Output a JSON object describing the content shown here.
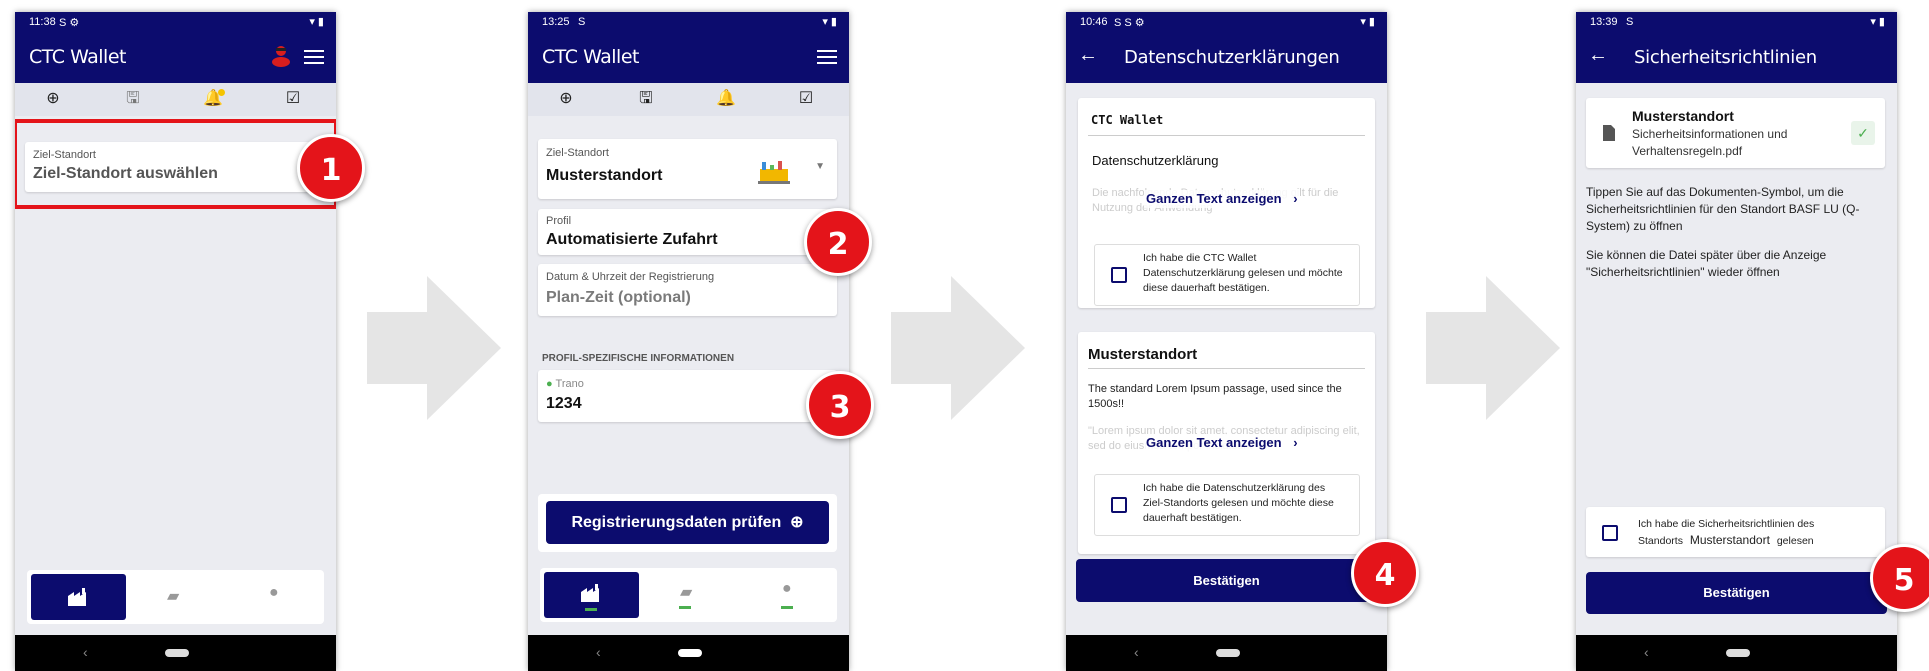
{
  "screens": [
    {
      "status_time": "11:38",
      "status_left_icons": "S ⚙",
      "app_title": "CTC Wallet",
      "field": {
        "label": "Ziel-Standort",
        "value": "Ziel-Standort auswählen"
      },
      "badge": "1"
    },
    {
      "status_time": "13:25",
      "status_left_icons": "S",
      "app_title": "CTC Wallet",
      "target": {
        "label": "Ziel-Standort",
        "value": "Musterstandort"
      },
      "profile": {
        "label": "Profil",
        "value": "Automatisierte Zufahrt"
      },
      "datetime": {
        "label": "Datum & Uhrzeit der Registrierung",
        "value": "Plan-Zeit (optional)"
      },
      "section_header": "PROFIL-SPEZIFISCHE INFORMATIONEN",
      "trano": {
        "label": "Trano",
        "value": "1234"
      },
      "primary_button": "Registrierungsdaten prüfen",
      "badge_2": "2",
      "badge_3": "3"
    },
    {
      "status_time": "10:46",
      "status_left_icons": "S S ⚙",
      "page_title": "Datenschutzerklärungen",
      "card1": {
        "org": "CTC Wallet",
        "heading": "Datenschutzerklärung",
        "faded_text": "Die nachfolgende Datenschutzerklärung gilt für die Nutzung der Anwendung",
        "link": "Ganzen Text anzeigen",
        "checkbox_text": "Ich habe die CTC Wallet Datenschutzerklärung gelesen und möchte diese dauerhaft bestätigen."
      },
      "card2": {
        "heading": "Musterstandort",
        "body": "The standard Lorem Ipsum passage, used since the 1500s!!",
        "faded_text": "\"Lorem ipsum dolor sit amet, consectetur adipiscing elit, sed do eiusmod tempor incididunt",
        "link": "Ganzen Text anzeigen",
        "checkbox_text": "Ich habe die Datenschutzerklärung des Ziel-Standorts gelesen und möchte diese dauerhaft bestätigen."
      },
      "confirm_button": "Bestätigen",
      "badge": "4"
    },
    {
      "status_time": "13:39",
      "status_left_icons": "S",
      "page_title": "Sicherheitsrichtlinien",
      "doc": {
        "title": "Musterstandort",
        "filename": "Sicherheitsinformationen und Verhaltensregeln.pdf"
      },
      "info1": "Tippen Sie auf das Dokumenten-Symbol, um die Sicherheitsrichtlinien für den Standort  BASF LU (Q-System) zu öffnen",
      "info2": "Sie können die Datei später über die Anzeige \"Sicherheitsrichtlinien\" wieder öffnen",
      "checkbox_text_a": "Ich habe die Sicherheitsrichtlinien des",
      "checkbox_text_b": "Standorts",
      "checkbox_site": "Musterstandort",
      "checkbox_text_c": "gelesen",
      "confirm_button": "Bestätigen",
      "badge": "5"
    }
  ],
  "colors": {
    "primary": "#0c0c6e",
    "badge": "#e4141a",
    "highlight_border": "#e4141a",
    "arrow": "#e5e5e5",
    "success": "#4caf50"
  }
}
